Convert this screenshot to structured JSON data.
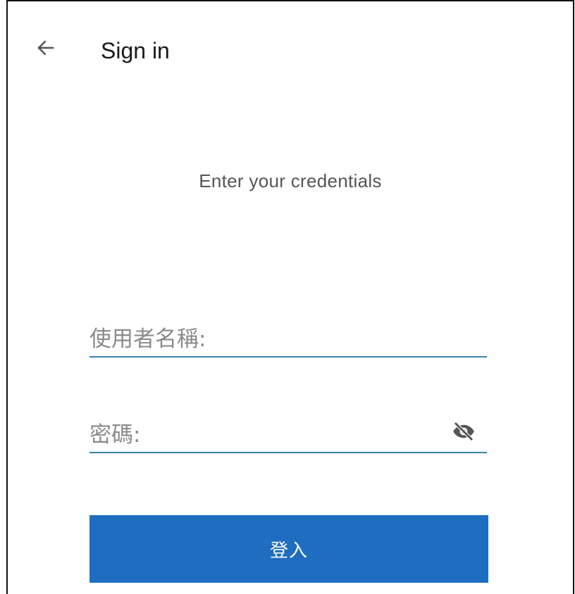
{
  "header": {
    "back_icon": "arrow-left-icon",
    "title": "Sign in"
  },
  "form": {
    "subtitle": "Enter your credentials",
    "username": {
      "placeholder": "使用者名稱:",
      "value": ""
    },
    "password": {
      "placeholder": "密碼:",
      "value": "",
      "toggle_icon": "eye-off-icon"
    },
    "submit_label": "登入"
  },
  "colors": {
    "accent": "#1f6dc1",
    "field_underline": "#3b82a8"
  }
}
